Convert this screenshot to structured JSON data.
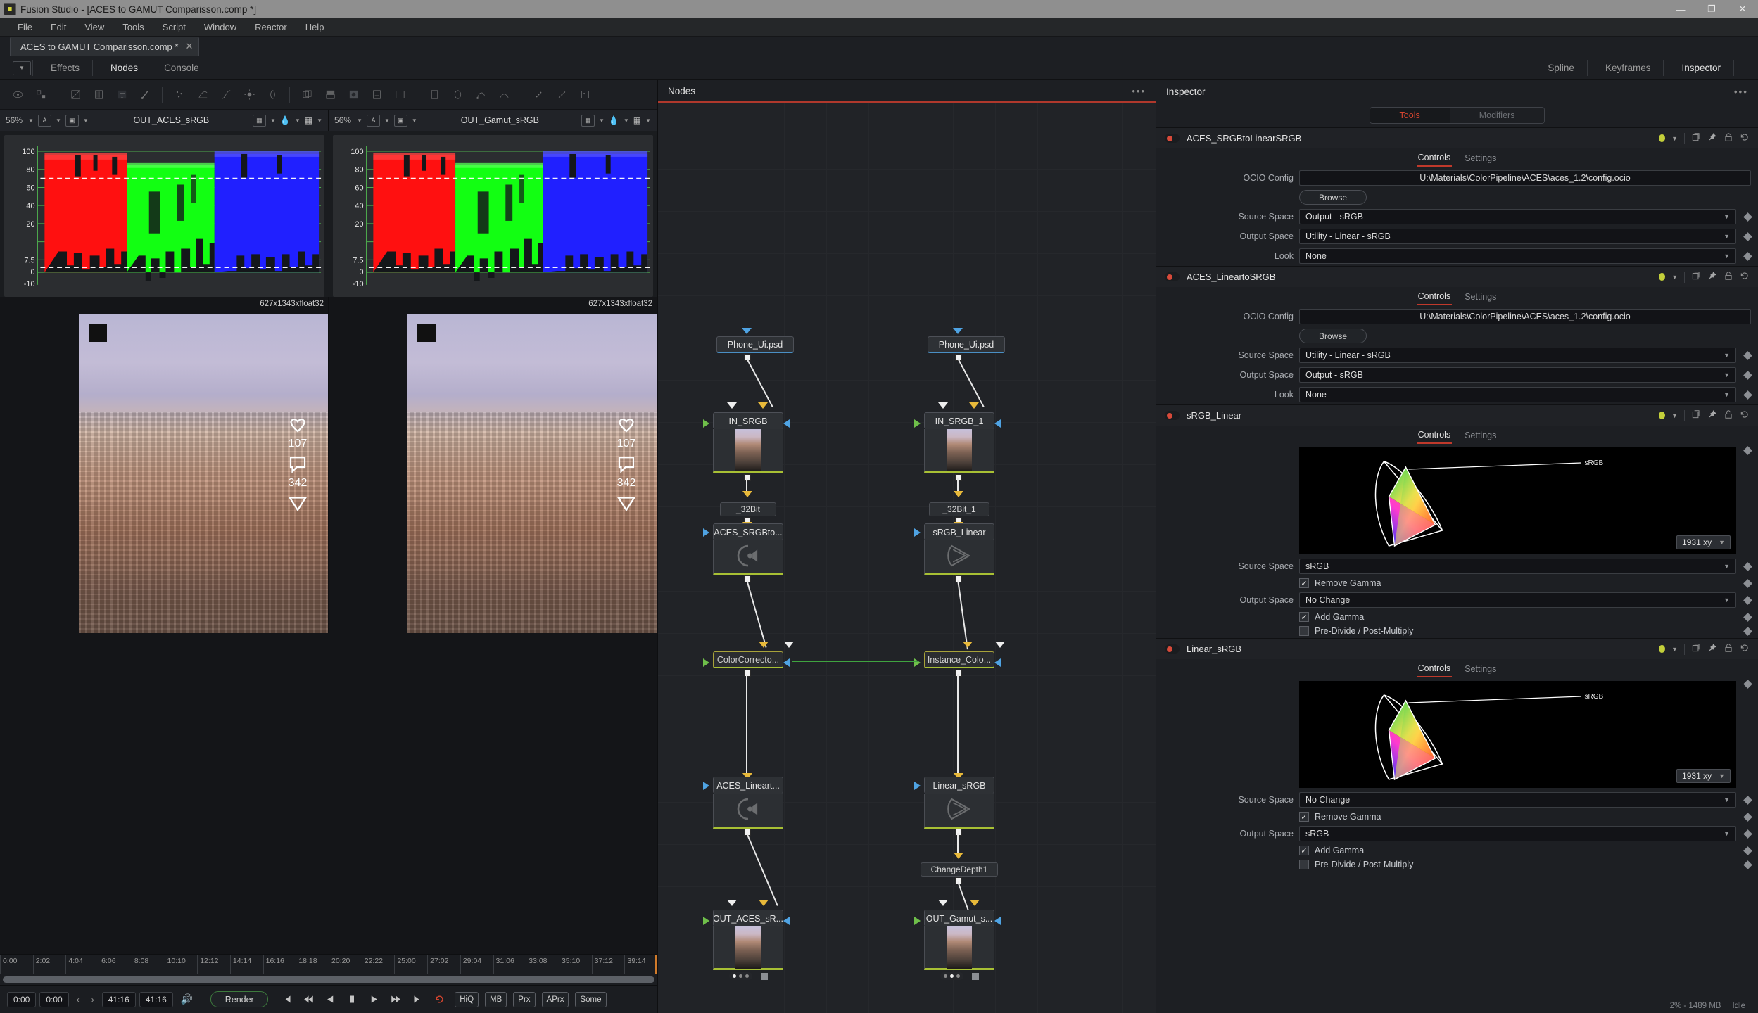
{
  "window": {
    "app_title": "Fusion Studio - [ACES to GAMUT Comparisson.comp *]",
    "minimize": "—",
    "maximize": "❐",
    "close": "✕"
  },
  "menubar": [
    "File",
    "Edit",
    "View",
    "Tools",
    "Script",
    "Window",
    "Reactor",
    "Help"
  ],
  "comp_tab": {
    "label": "ACES to GAMUT Comparisson.comp *",
    "close": "✕"
  },
  "toolbar": {
    "effects": "Effects",
    "nodes": "Nodes",
    "console": "Console",
    "spline": "Spline",
    "keyframes": "Keyframes",
    "inspector": "Inspector"
  },
  "viewers": [
    {
      "zoom": "56%",
      "buffer": "A",
      "name": "OUT_ACES_sRGB",
      "resolution": "627x1343xfloat32"
    },
    {
      "zoom": "56%",
      "buffer": "A",
      "name": "OUT_Gamut_sRGB",
      "resolution": "627x1343xfloat32"
    }
  ],
  "phone_overlay": {
    "likes": "107",
    "comments": "342"
  },
  "scope": {
    "type": "waveform-rgb-parade",
    "y_ticks": [
      "100",
      "80",
      "60",
      "40",
      "20",
      "7.5",
      "0",
      "-10"
    ],
    "channels": [
      "red",
      "green",
      "blue"
    ]
  },
  "timeline": {
    "marks": [
      "0:00",
      "2:02",
      "4:04",
      "6:06",
      "8:08",
      "10:10",
      "12:12",
      "14:14",
      "16:16",
      "18:18",
      "20:20",
      "22:22",
      "25:00",
      "27:02",
      "29:04",
      "31:06",
      "33:08",
      "35:10",
      "37:12",
      "39:14"
    ],
    "start": "0:00",
    "current": "0:00",
    "end": "41:16",
    "total": "41:16",
    "render": "Render",
    "quality": [
      "HiQ",
      "MB",
      "Prx",
      "APrx",
      "Some"
    ]
  },
  "nodes_panel": {
    "title": "Nodes",
    "dots": "•••"
  },
  "nodes": [
    {
      "id": "phone_a",
      "label": "Phone_Ui.psd",
      "type": "loader"
    },
    {
      "id": "in_srgb",
      "label": "IN_SRGB",
      "type": "saver-thumb"
    },
    {
      "id": "b32",
      "label": "_32Bit",
      "type": "small"
    },
    {
      "id": "aces_s2l",
      "label": "ACES_SRGBto...",
      "type": "ocio"
    },
    {
      "id": "cc",
      "label": "ColorCorrecto...",
      "type": "title-only"
    },
    {
      "id": "aces_l2s",
      "label": "ACES_Lineart...",
      "type": "ocio"
    },
    {
      "id": "out_aces",
      "label": "OUT_ACES_sR...",
      "type": "saver-thumb"
    },
    {
      "id": "phone_b",
      "label": "Phone_Ui.psd",
      "type": "loader"
    },
    {
      "id": "in_srgb1",
      "label": "IN_SRGB_1",
      "type": "saver-thumb"
    },
    {
      "id": "b32_1",
      "label": "_32Bit_1",
      "type": "small"
    },
    {
      "id": "srgb_lin",
      "label": "sRGB_Linear",
      "type": "gamut"
    },
    {
      "id": "inst_cc",
      "label": "Instance_Colo...",
      "type": "instance"
    },
    {
      "id": "lin_srgb",
      "label": "Linear_sRGB",
      "type": "gamut"
    },
    {
      "id": "chdepth",
      "label": "ChangeDepth1",
      "type": "small"
    },
    {
      "id": "out_gam",
      "label": "OUT_Gamut_s...",
      "type": "saver-thumb"
    }
  ],
  "inspector": {
    "title": "Inspector",
    "dots": "•••",
    "segmented": {
      "tools": "Tools",
      "modifiers": "Modifiers"
    },
    "tabs": {
      "controls": "Controls",
      "settings": "Settings"
    },
    "labels": {
      "ocio_config": "OCIO Config",
      "browse": "Browse",
      "source_space": "Source Space",
      "output_space": "Output Space",
      "look": "Look",
      "remove_gamma": "Remove Gamma",
      "add_gamma": "Add Gamma",
      "predivide": "Pre-Divide / Post-Multiply",
      "colorspace_mode": "1931 xy",
      "gamut_tag": "sRGB"
    },
    "tools": [
      {
        "name": "ACES_SRGBtoLinearSRGB",
        "kind": "ocio",
        "ocio_config": "U:\\Materials\\ColorPipeline\\ACES\\aces_1.2\\config.ocio",
        "source_space": "Output - sRGB",
        "output_space": "Utility - Linear - sRGB",
        "look": "None"
      },
      {
        "name": "ACES_LineartoSRGB",
        "kind": "ocio",
        "ocio_config": "U:\\Materials\\ColorPipeline\\ACES\\aces_1.2\\config.ocio",
        "source_space": "Utility - Linear - sRGB",
        "output_space": "Output - sRGB",
        "look": "None"
      },
      {
        "name": "sRGB_Linear",
        "kind": "gamut",
        "source_space": "sRGB",
        "output_space": "No Change",
        "remove_gamma": true,
        "add_gamma": true,
        "predivide": false,
        "colorspace_mode": "1931 xy",
        "gamut_tag": "sRGB"
      },
      {
        "name": "Linear_sRGB",
        "kind": "gamut",
        "source_space": "No Change",
        "output_space": "sRGB",
        "remove_gamma": true,
        "add_gamma": true,
        "predivide": false,
        "colorspace_mode": "1931 xy",
        "gamut_tag": "sRGB"
      }
    ]
  },
  "statusbar": {
    "memory": "2% - 1489 MB",
    "state": "Idle"
  }
}
